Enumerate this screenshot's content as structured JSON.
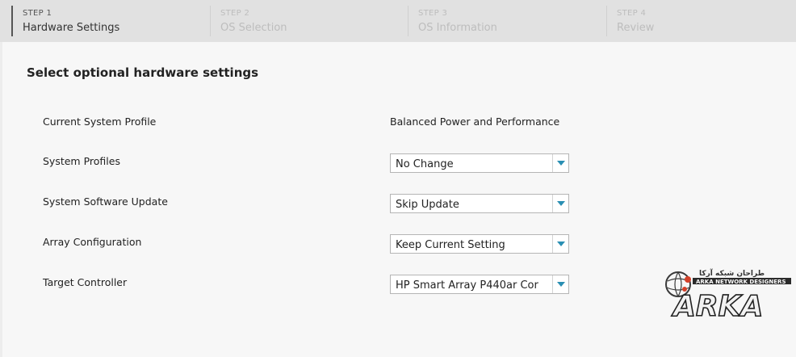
{
  "steps": [
    {
      "num": "STEP 1",
      "name": "Hardware Settings",
      "active": true
    },
    {
      "num": "STEP 2",
      "name": "OS Selection",
      "active": false
    },
    {
      "num": "STEP 3",
      "name": "OS Information",
      "active": false
    },
    {
      "num": "STEP 4",
      "name": "Review",
      "active": false
    }
  ],
  "panel": {
    "title": "Select optional hardware settings",
    "rows": [
      {
        "label": "Current System Profile",
        "value": "Balanced Power and Performance"
      },
      {
        "label": "System Profiles",
        "selected": "No Change"
      },
      {
        "label": "System Software Update",
        "selected": "Skip Update"
      },
      {
        "label": "Array Configuration",
        "selected": "Keep Current Setting"
      },
      {
        "label": "Target Controller",
        "selected": "HP Smart Array P440ar Cor"
      }
    ]
  },
  "watermark": {
    "text": "ARKA",
    "subtitle": "ARKA NETWORK DESIGNERS",
    "persian": "طراحان شبکه آرکا"
  },
  "colors": {
    "accent": "#2a8fb3",
    "stepbar_bg": "#e1e1e1",
    "panel_bg": "#f7f7f7"
  }
}
